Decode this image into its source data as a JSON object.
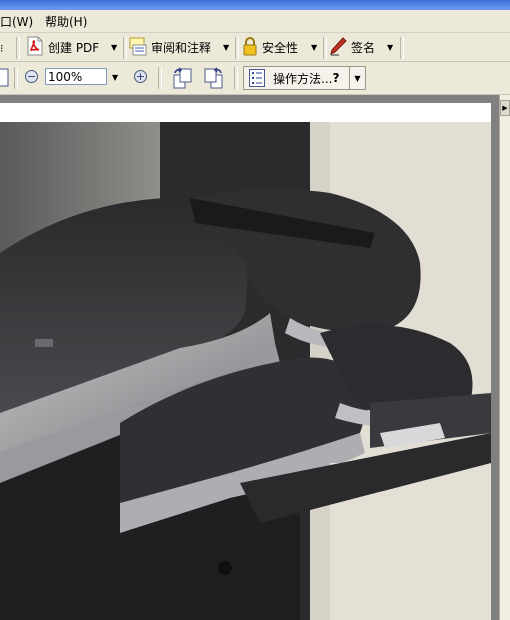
{
  "menu": {
    "window_label": "窗口(W)",
    "help_label": "帮助(H)"
  },
  "toolbar": {
    "create_pdf_label": "创建 PDF",
    "review_label": "审阅和注释",
    "security_label": "安全性",
    "sign_label": "签名"
  },
  "nav": {
    "zoom_value": "100%",
    "how_to_label": "操作方法...",
    "how_to_help_glyph": "?"
  },
  "colors": {
    "background": "#ece9d8",
    "accent_blue": "#3a6fd8"
  }
}
